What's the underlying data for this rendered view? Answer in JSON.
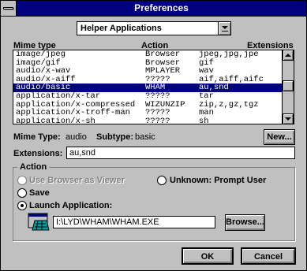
{
  "window": {
    "title": "Preferences"
  },
  "category": {
    "selected": "Helper Applications"
  },
  "list": {
    "headers": {
      "mime": "Mime type",
      "action": "Action",
      "ext": "Extensions"
    },
    "rows": [
      {
        "mime": "image/jpeg",
        "action": "Browser",
        "ext": "jpeg,jpg,jpe"
      },
      {
        "mime": "image/gif",
        "action": "Browser",
        "ext": "gif"
      },
      {
        "mime": "audio/x-wav",
        "action": "MPLAYER",
        "ext": "wav"
      },
      {
        "mime": "audio/x-aiff",
        "action": "?????",
        "ext": "aif,aiff,aifc"
      },
      {
        "mime": "audio/basic",
        "action": "WHAM",
        "ext": "au,snd"
      },
      {
        "mime": "application/x-tar",
        "action": "?????",
        "ext": "tar"
      },
      {
        "mime": "application/x-compressed",
        "action": "WIZUNZIP",
        "ext": "zip,z,gz,tgz"
      },
      {
        "mime": "application/x-troff-man",
        "action": "?????",
        "ext": "man"
      },
      {
        "mime": "application/x-sh",
        "action": "?????",
        "ext": "sh"
      }
    ],
    "selected_index": 4
  },
  "mime_info": {
    "type_label": "Mime Type:",
    "type_value": "audio",
    "subtype_label": "Subtype:",
    "subtype_value": "basic",
    "new_button": "New..."
  },
  "extensions": {
    "label": "Extensions:",
    "value": "au,snd"
  },
  "action_group": {
    "title": "Action",
    "use_browser": "Use Browser as Viewer",
    "unknown": "Unknown:  Prompt User",
    "save": "Save",
    "launch": "Launch Application:",
    "app_path": "I:\\LYD\\WHAM\\WHAM.EXE",
    "browse_button": "Browse...",
    "selected": "launch",
    "app_icon": "application-program-icon"
  },
  "buttons": {
    "ok": "OK",
    "cancel": "Cancel"
  }
}
